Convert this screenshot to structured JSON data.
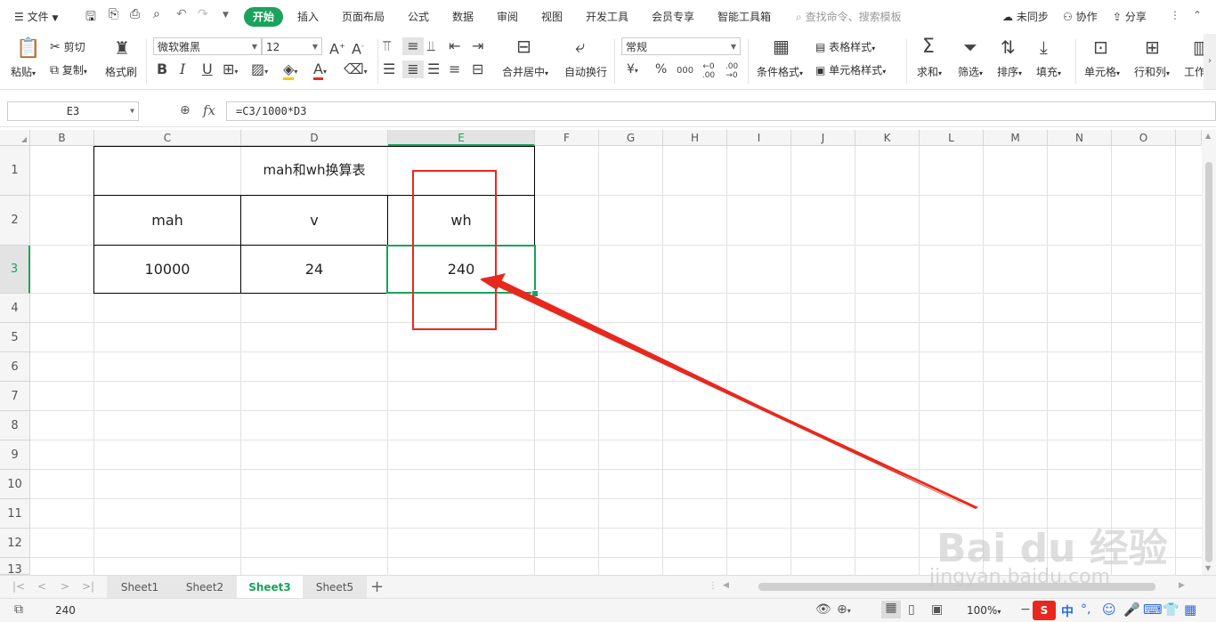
{
  "menubar": {
    "file_label": "文件",
    "tabs": [
      "开始",
      "插入",
      "页面布局",
      "公式",
      "数据",
      "审阅",
      "视图",
      "开发工具",
      "会员专享",
      "智能工具箱"
    ],
    "search_placeholder": "查找命令、搜索模板",
    "sync_label": "未同步",
    "collab_label": "协作",
    "share_label": "分享"
  },
  "ribbon": {
    "paste": "粘贴",
    "cut": "剪切",
    "copy": "复制",
    "format_painter": "格式刷",
    "font_name": "微软雅黑",
    "font_size": "12",
    "merge_center": "合并居中",
    "wrap_text": "自动换行",
    "number_format": "常规",
    "conditional_format": "条件格式",
    "table_style": "表格样式",
    "cell_style": "单元格样式",
    "sum": "求和",
    "filter": "筛选",
    "sort": "排序",
    "fill": "填充",
    "cells": "单元格",
    "rows_cols": "行和列",
    "worksheet": "工作",
    "bold": "B",
    "italic": "I",
    "underline": "U",
    "currency": "¥",
    "percent": "%",
    "thousands": "000",
    "dec_inc": "←0 .00",
    "dec_dec": ".00 →0"
  },
  "formula_bar": {
    "name_box": "E3",
    "fx": "fx",
    "formula": "=C3/1000*D3"
  },
  "grid": {
    "columns": [
      "B",
      "C",
      "D",
      "E",
      "F",
      "G",
      "H",
      "I",
      "J",
      "K",
      "L",
      "M",
      "N",
      "O"
    ],
    "rows": [
      "1",
      "2",
      "3",
      "4",
      "5",
      "6",
      "7",
      "8",
      "9",
      "10",
      "11",
      "12",
      "13"
    ],
    "cells": {
      "title": "mah和wh换算表",
      "c2": "mah",
      "d2": "v",
      "e2": "wh",
      "c3": "10000",
      "d3": "24",
      "e3": "240"
    }
  },
  "sheets": [
    "Sheet1",
    "Sheet2",
    "Sheet3",
    "Sheet5"
  ],
  "active_sheet": "Sheet3",
  "status": {
    "cell_value": "240",
    "zoom": "100%",
    "ime_lang": "中"
  },
  "watermark": {
    "brand": "Bai du 经验",
    "url": "jingyan.baidu.com"
  },
  "colors": {
    "accent": "#1aa35b",
    "annotation": "#e8281e"
  }
}
